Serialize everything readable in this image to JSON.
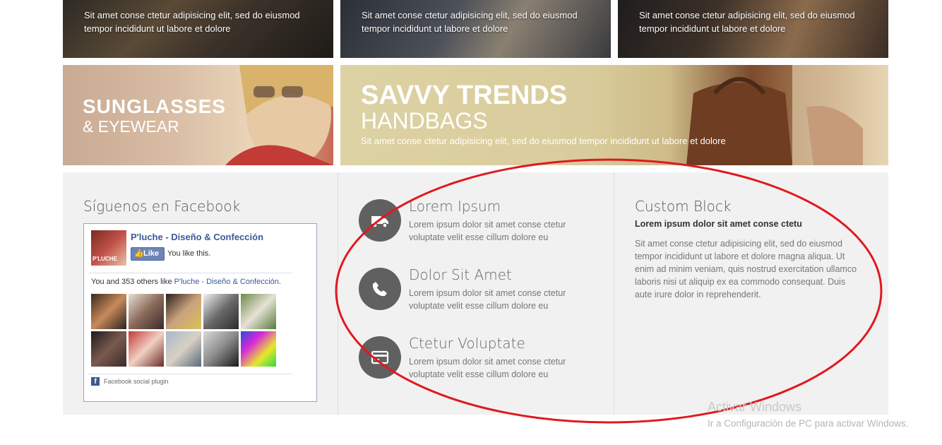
{
  "tiles": [
    {
      "caption": "Sit amet conse ctetur adipisicing elit, sed do eiusmod tempor incididunt ut labore et dolore"
    },
    {
      "caption": "Sit amet conse ctetur adipisicing elit, sed do eiusmod tempor incididunt ut labore et dolore"
    },
    {
      "caption": "Sit amet conse ctetur adipisicing elit, sed do eiusmod tempor incididunt ut labore et dolore"
    }
  ],
  "banner_sunglasses": {
    "title": "SUNGLASSES",
    "subtitle": "& EYEWEAR"
  },
  "banner_trends": {
    "title": "SAVVY TRENDS",
    "subtitle": "HANDBAGS",
    "text": "Sit amet conse ctetur adipisicing elit, sed do eiusmod tempor incididunt ut labore et dolore"
  },
  "facebook": {
    "heading": "Síguenos en Facebook",
    "page_name": "P'luche - Diseño & Confección",
    "thumb_label": "P'LUCHE",
    "like_label": "Like",
    "you_like": "You like this.",
    "count_prefix": "You and 353 others like ",
    "count_page": "P'luche - Diseño & Confección",
    "count_suffix": ".",
    "plugin_label": "Facebook social plugin"
  },
  "features": [
    {
      "icon": "truck-icon",
      "title": "Lorem Ipsum",
      "text": "Lorem ipsum dolor sit amet conse ctetur voluptate velit esse cillum dolore eu"
    },
    {
      "icon": "phone-icon",
      "title": "Dolor Sit Amet",
      "text": "Lorem ipsum dolor sit amet conse ctetur voluptate velit esse cillum dolore eu"
    },
    {
      "icon": "credit-card-icon",
      "title": "Ctetur Voluptate",
      "text": "Lorem ipsum dolor sit amet conse ctetur voluptate velit esse cillum dolore eu"
    }
  ],
  "custom_block": {
    "heading": "Custom Block",
    "strong": "Lorem ipsum dolor sit amet conse ctetu",
    "text": "Sit amet conse ctetur adipisicing elit, sed do eiusmod tempor incididunt ut labore et dolore magna aliqua. Ut enim ad minim veniam, quis nostrud exercitation ullamco laboris nisi ut aliquip ex ea commodo consequat. Duis aute irure dolor in reprehenderit."
  },
  "watermark": {
    "line1": "Activar Windows",
    "line2": "Ir a Configuración de PC para activar Windows."
  },
  "colors": {
    "annotation": "#e0191e",
    "facebook_blue": "#3b5998",
    "panel_bg": "#f1f1f1"
  }
}
